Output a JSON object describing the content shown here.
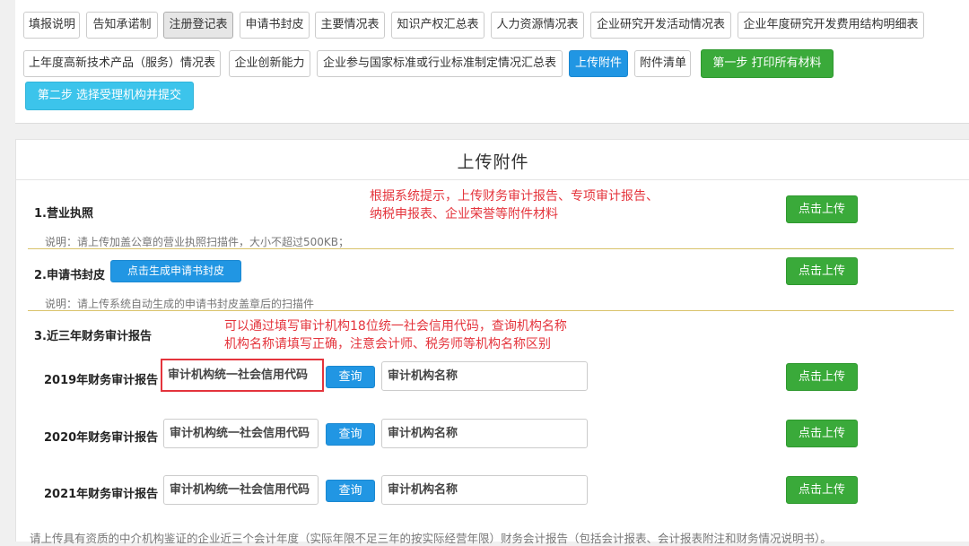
{
  "tabs_row1": [
    "填报说明",
    "告知承诺制",
    "注册登记表",
    "申请书封皮",
    "主要情况表",
    "知识产权汇总表",
    "人力资源情况表",
    "企业研究开发活动情况表",
    "企业年度研究开发费用结构明细表"
  ],
  "tabs_row2": [
    "上年度高新技术产品（服务）情况表",
    "企业创新能力",
    "企业参与国家标准或行业标准制定情况汇总表",
    "上传附件",
    "附件清单"
  ],
  "step1_label": "第一步 打印所有材料",
  "step2_label": "第二步 选择受理机构并提交",
  "section_title": "上传附件",
  "annotation_top": [
    "根据系统提示，上传财务审计报告、专项审计报告、",
    "纳税申报表、企业荣誉等附件材料"
  ],
  "annotation_mid": [
    "可以通过填写审计机构18位统一社会信用代码，查询机构名称",
    "机构名称请填写正确，注意会计师、税务师等机构名称区别"
  ],
  "item1": {
    "label": "1.营业执照",
    "note": "说明：请上传加盖公章的营业执照扫描件，大小不超过500KB；"
  },
  "item2": {
    "label": "2.申请书封皮",
    "generate_label": "点击生成申请书封皮",
    "note": "说明：请上传系统自动生成的申请书封皮盖章后的扫描件"
  },
  "item3": {
    "label": "3.近三年财务审计报告"
  },
  "upload_label": "点击上传",
  "query_label": "查询",
  "code_placeholder": "审计机构统一社会信用代码",
  "name_placeholder": "审计机构名称",
  "years": [
    "2019年财务审计报告",
    "2020年财务审计报告",
    "2021年财务审计报告"
  ],
  "bottom_note": "请上传具有资质的中介机构鉴证的企业近三个会计年度（实际年限不足三年的按实际经营年限）财务会计报告（包括会计报表、会计报表附注和财务情况说明书）。",
  "colors": {
    "green": "#3aaa3a",
    "blue": "#2196e3",
    "cyan": "#3cc4eb",
    "red": "#e4343c"
  }
}
